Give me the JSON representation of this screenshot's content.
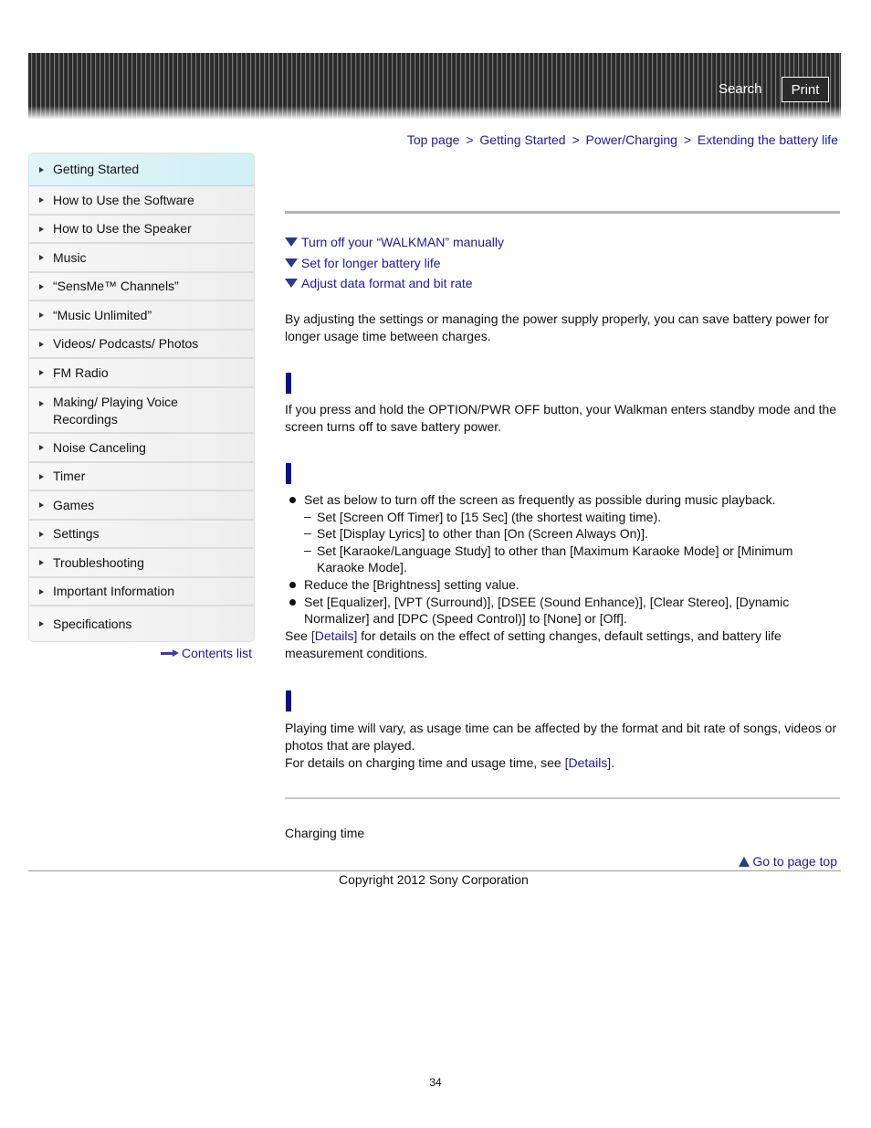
{
  "header": {
    "search_label": "Search",
    "print_label": "Print"
  },
  "breadcrumb": [
    "Top page",
    "Getting Started",
    "Power/Charging",
    "Extending the battery life"
  ],
  "breadcrumb_sep": ">",
  "sidebar": {
    "items": [
      {
        "label": "Getting Started",
        "active": true
      },
      {
        "label": "How to Use the Software"
      },
      {
        "label": "How to Use the Speaker"
      },
      {
        "label": "Music"
      },
      {
        "label": "“SensMe™ Channels”"
      },
      {
        "label": "“Music Unlimited”"
      },
      {
        "label": "Videos/ Podcasts/ Photos"
      },
      {
        "label": "FM Radio"
      },
      {
        "label": "Making/ Playing Voice Recordings"
      },
      {
        "label": "Noise Canceling"
      },
      {
        "label": "Timer"
      },
      {
        "label": "Games"
      },
      {
        "label": "Settings"
      },
      {
        "label": "Troubleshooting"
      },
      {
        "label": "Important Information"
      },
      {
        "label": "Specifications"
      }
    ],
    "contents_list": "Contents list"
  },
  "toc": [
    "Turn off your “WALKMAN” manually",
    "Set for longer battery life",
    "Adjust data format and bit rate"
  ],
  "intro": "By adjusting the settings or managing the power supply properly, you can save battery power for longer usage time between charges.",
  "section1": {
    "text": "If you press and hold the OPTION/PWR OFF button, your Walkman enters standby mode and the screen turns off to save battery power."
  },
  "section2": {
    "bullet1": "Set as below to turn off the screen as frequently as possible during music playback.",
    "sub": [
      "Set [Screen Off Timer] to [15 Sec] (the shortest waiting time).",
      "Set [Display Lyrics] to other than [On (Screen Always On)].",
      "Set [Karaoke/Language Study] to other than [Maximum Karaoke Mode] or [Minimum Karaoke Mode]."
    ],
    "bullet2": "Reduce the [Brightness] setting value.",
    "bullet3": "Set [Equalizer], [VPT (Surround)], [DSEE (Sound Enhance)], [Clear Stereo], [Dynamic Normalizer] and [DPC (Speed Control)] to [None] or [Off].",
    "see_prefix": "See ",
    "see_link": "[Details]",
    "see_suffix": " for details on the effect of setting changes, default settings, and battery life measurement conditions."
  },
  "section3": {
    "text1": "Playing time will vary, as usage time can be affected by the format and bit rate of songs, videos or photos that are played.",
    "text2_prefix": "For details on charging time and usage time, see ",
    "text2_link": "[Details]",
    "text2_suffix": "."
  },
  "related": {
    "link": "Charging time"
  },
  "go_top": "Go to page top",
  "copyright": "Copyright 2012 Sony Corporation",
  "page_number": "34"
}
